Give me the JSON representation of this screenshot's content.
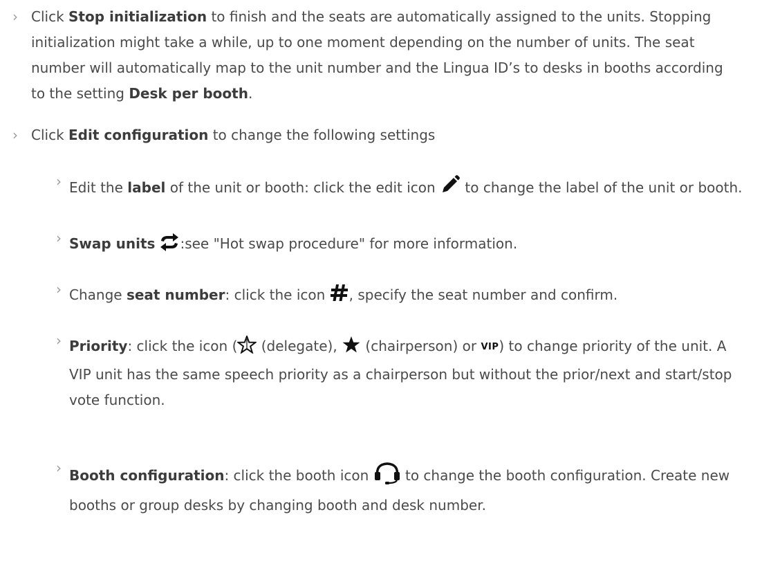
{
  "items": [
    {
      "bullet": "›",
      "p1": "Click ",
      "b1": "Stop initialization",
      "p2": " to finish and the seats are automatically assigned to the units. Stopping initialization might take a while, up to one moment depending on the number of units. The seat number will automatically map to the unit number and the Lingua ID’s to desks in booths according to the setting ",
      "b2": "Desk per booth",
      "p3": "."
    },
    {
      "bullet": "›",
      "p1": "Click ",
      "b1": "Edit configuration",
      "p2": " to change the following settings"
    }
  ],
  "sub_items": [
    {
      "bullet": "›",
      "p1": "Edit the ",
      "b1": "label",
      "p2": " of the unit or booth: click the edit icon ",
      "icon": "pencil-icon",
      "p3": " to change the label of the unit or booth."
    },
    {
      "bullet": "›",
      "b1": "Swap units",
      "icon": "swap-arrows-icon",
      "p2": ":see \"Hot swap procedure\" for more information."
    },
    {
      "bullet": "›",
      "p1": "Change ",
      "b1": "seat number",
      "p2": ": click the icon ",
      "icon": "hash-icon",
      "p3": ", specify the seat number and confirm."
    },
    {
      "bullet": "›",
      "b1": "Priority",
      "p1": ": click the icon (",
      "icon1": "star-outline-icon",
      "p2": " (delegate), ",
      "icon2": "star-filled-icon",
      "p3": " (chairperson) or ",
      "vip": "VIP",
      "p4": ") to change priority of the unit. A VIP unit has the same speech priority as a chairperson but without the prior/next and start/stop vote function."
    },
    {
      "bullet": "›",
      "b1": "Booth configuration",
      "p1": ": click the booth icon ",
      "icon": "headset-icon",
      "p2": " to change the booth configuration. Create new booths or group desks by changing booth and desk number."
    }
  ]
}
